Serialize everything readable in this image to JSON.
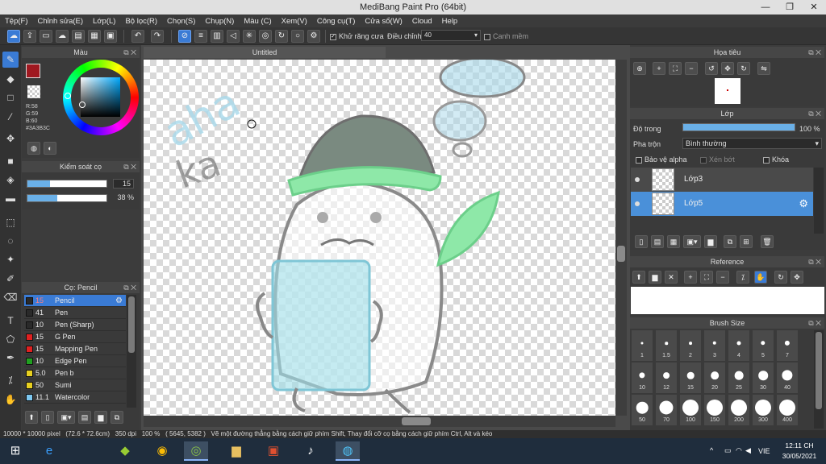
{
  "window": {
    "title": "MediBang Paint Pro (64bit)"
  },
  "menu": [
    "Tệp(F)",
    "Chỉnh sửa(E)",
    "Lớp(L)",
    "Bộ lọc(R)",
    "Chọn(S)",
    "Chụp(N)",
    "Màu (C)",
    "Xem(V)",
    "Công cụ(T)",
    "Cửa sổ(W)",
    "Cloud",
    "Help"
  ],
  "toolbar": {
    "antialias_label": "Khử răng cưa",
    "adjust_label": "Điều chỉnh",
    "adjust_value": "40",
    "smooth_label": "Canh mềm"
  },
  "color_panel": {
    "title": "Màu",
    "r": "R:58",
    "g": "G:59",
    "b": "B:60",
    "hex": "#3A3B3C",
    "primary": "#a01820",
    "secondary": "#3a3b3c"
  },
  "brush_control": {
    "title": "Kiểm soát cọ",
    "size": "15",
    "opacity": "38 %"
  },
  "brush_panel": {
    "title": "Cọ: Pencil",
    "items": [
      {
        "size": "15",
        "name": "Pencil",
        "color": "#2a2a2a"
      },
      {
        "size": "41",
        "name": "Pen",
        "color": "#2a2a2a"
      },
      {
        "size": "10",
        "name": "Pen (Sharp)",
        "color": "#2a2a2a"
      },
      {
        "size": "15",
        "name": "G Pen",
        "color": "#e02020"
      },
      {
        "size": "15",
        "name": "Mapping Pen",
        "color": "#e02020"
      },
      {
        "size": "10",
        "name": "Edge Pen",
        "color": "#20a020"
      },
      {
        "size": "5.0",
        "name": "Pen b",
        "color": "#e8d020"
      },
      {
        "size": "50",
        "name": "Sumi",
        "color": "#e8d020"
      },
      {
        "size": "11.1",
        "name": "Watercolor",
        "color": "#7ec8f0"
      }
    ]
  },
  "document": {
    "tab_title": "Untitled",
    "doodle_text_1": "aha",
    "doodle_text_2": "ka"
  },
  "navigator": {
    "title": "Họa tiêu"
  },
  "layer_panel": {
    "title": "Lớp",
    "opacity_label": "Độ trong",
    "opacity_value": "100 %",
    "blend_label": "Pha trộn",
    "blend_value": "Bình thường",
    "protect_alpha": "Bảo vệ alpha",
    "clipping": "Xén bớt",
    "lock": "Khóa",
    "layers": [
      {
        "name": "Lớp3"
      },
      {
        "name": "Lớp5"
      }
    ]
  },
  "reference": {
    "title": "Reference"
  },
  "brush_size": {
    "title": "Brush Size",
    "sizes": [
      "1",
      "1.5",
      "2",
      "3",
      "4",
      "5",
      "7",
      "10",
      "12",
      "15",
      "20",
      "25",
      "30",
      "40",
      "50",
      "70",
      "100",
      "150",
      "200",
      "300",
      "400"
    ]
  },
  "statusbar": {
    "size": "10000 * 10000 pixel",
    "cm": "(72.6 * 72.6cm)",
    "dpi": "350 dpi",
    "zoom": "100 %",
    "coords": "( 5645, 5382 )",
    "hint": "Vẽ một đường thẳng bằng cách giữ phím Shift, Thay đổi cỡ cọ bằng cách giữ phím Ctrl, Alt và kéo"
  },
  "taskbar": {
    "lang": "VIE",
    "time": "12:11 CH",
    "date": "30/05/2021"
  }
}
